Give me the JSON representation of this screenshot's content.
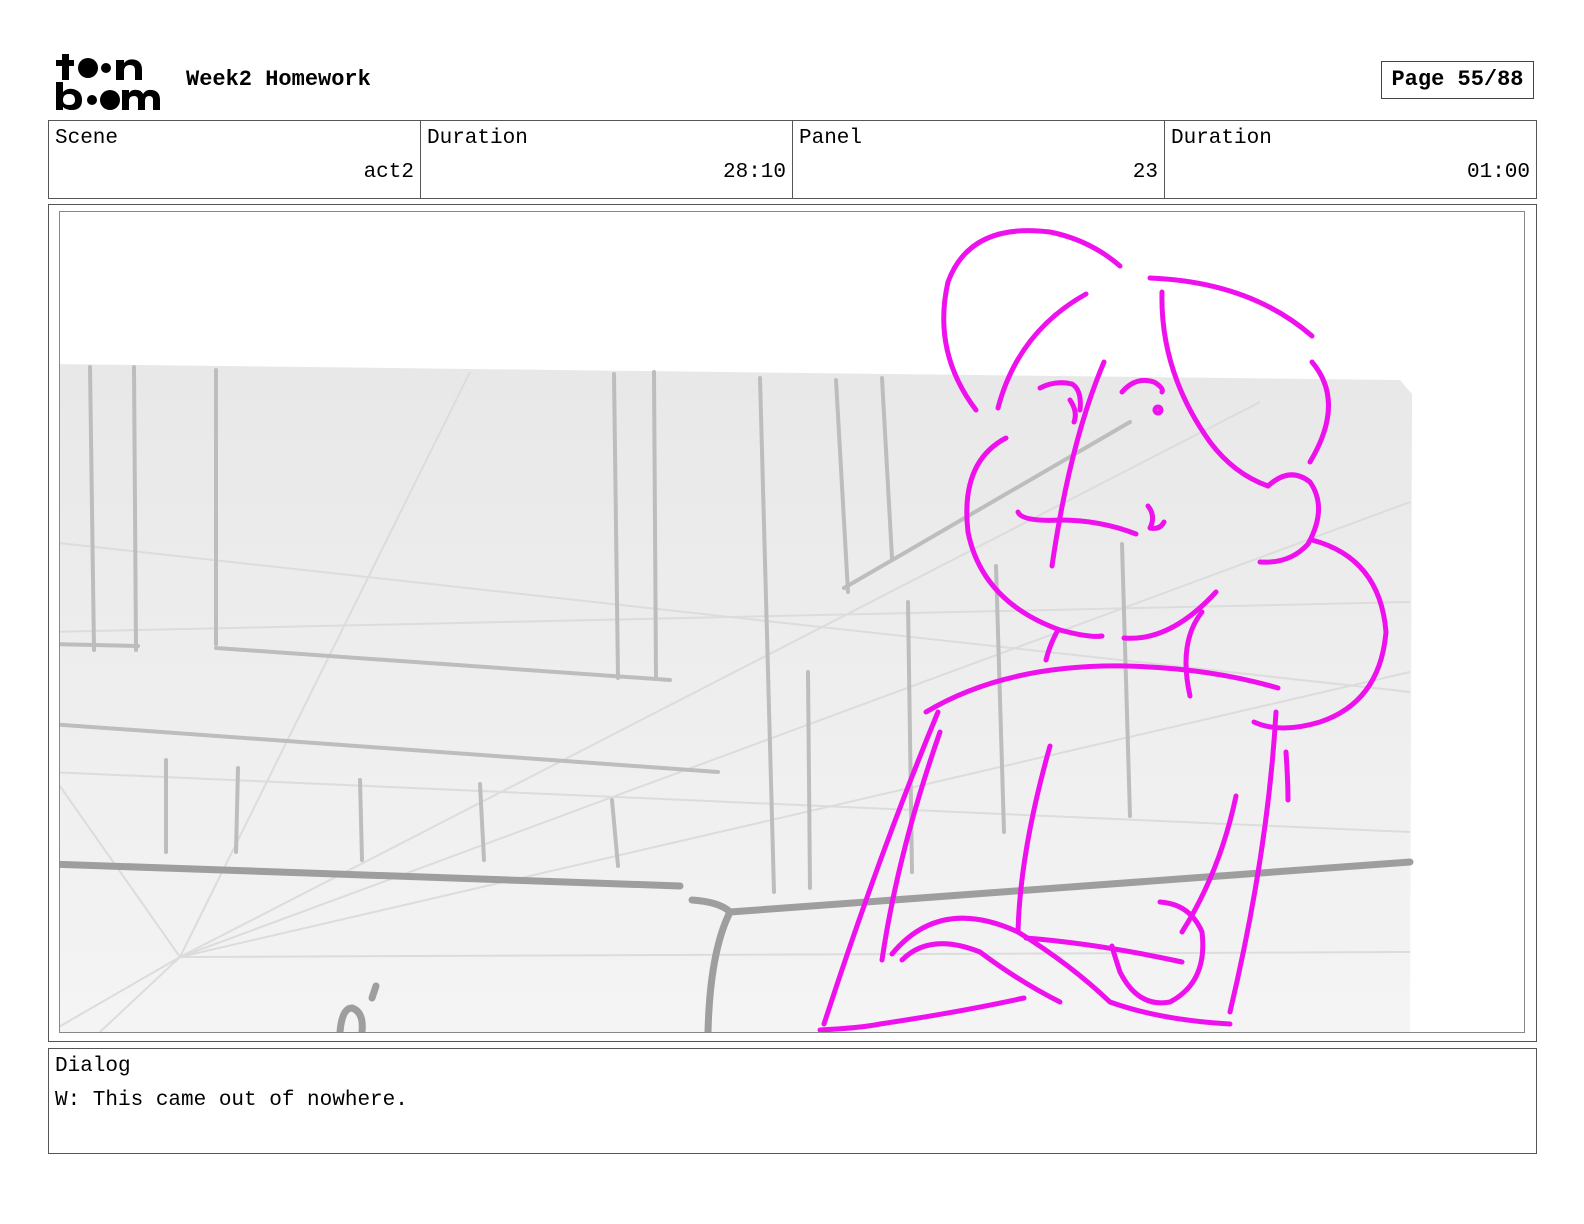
{
  "header": {
    "logo_text": "toon boom",
    "project_title": "Week2 Homework",
    "page_label": "Page 55/88"
  },
  "info": {
    "scene_label": "Scene",
    "scene_value": "act2",
    "scene_duration_label": "Duration",
    "scene_duration_value": "28:10",
    "panel_label": "Panel",
    "panel_value": "23",
    "panel_duration_label": "Duration",
    "panel_duration_value": "01:00"
  },
  "dialog": {
    "label": "Dialog",
    "text": "W: This came out of nowhere."
  },
  "colors": {
    "sketch_character": "#ee11ee",
    "sketch_background": "#a8a8a8"
  }
}
